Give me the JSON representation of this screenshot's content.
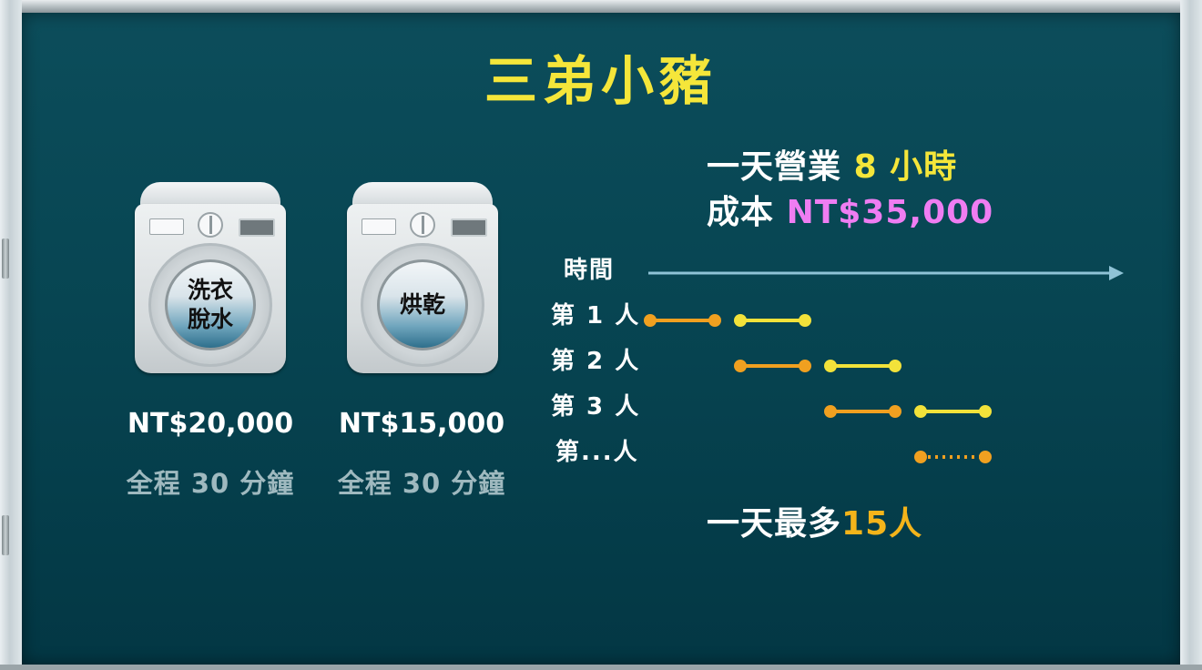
{
  "title": "三弟小豬",
  "machines": [
    {
      "label_line1": "洗衣",
      "label_line2": "脫水",
      "price": "NT$20,000",
      "duration": "全程 30 分鐘"
    },
    {
      "label_line1": "烘乾",
      "label_line2": "",
      "price": "NT$15,000",
      "duration": "全程 30 分鐘"
    }
  ],
  "business": {
    "hours_prefix": "一天營業",
    "hours_value": "8 小時",
    "cost_prefix": "成本",
    "cost_value": "NT$35,000"
  },
  "timeline": {
    "axis_label": "時間",
    "rows": [
      {
        "label": "第 1 人",
        "wash_slot": 0,
        "dry_slot": 1,
        "dotted": false
      },
      {
        "label": "第 2 人",
        "wash_slot": 1,
        "dry_slot": 2,
        "dotted": false
      },
      {
        "label": "第 3 人",
        "wash_slot": 2,
        "dry_slot": 3,
        "dotted": false
      },
      {
        "label": "第...人",
        "wash_slot": null,
        "dry_slot": 3,
        "dotted": true
      }
    ],
    "colors": {
      "wash": "#f0a020",
      "dry": "#f2e23a",
      "axis": "#8fc3d6"
    }
  },
  "summary": {
    "prefix": "一天最多",
    "value": "15人"
  }
}
